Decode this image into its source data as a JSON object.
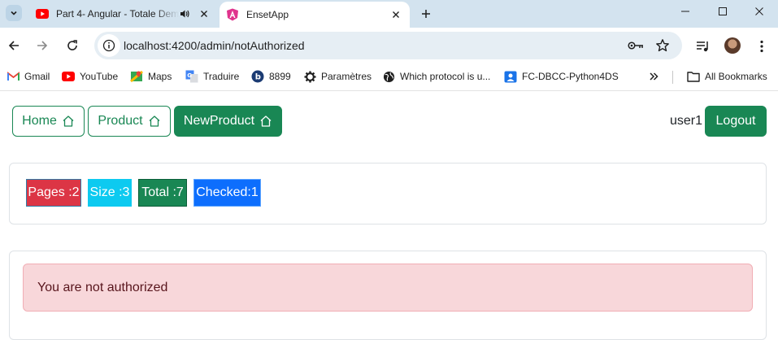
{
  "browser": {
    "tabs": [
      {
        "title": "Part 4- Angular - Totale Dem",
        "favicon": "youtube-icon",
        "active": false
      },
      {
        "title": "EnsetApp",
        "favicon": "angular-icon",
        "active": true
      }
    ],
    "url": "localhost:4200/admin/notAuthorized",
    "bookmarks": [
      {
        "label": "Gmail",
        "icon": "gmail-icon"
      },
      {
        "label": "YouTube",
        "icon": "youtube-icon"
      },
      {
        "label": "Maps",
        "icon": "maps-icon"
      },
      {
        "label": "Traduire",
        "icon": "translate-icon"
      },
      {
        "label": "8899",
        "icon": "b-logo-icon"
      },
      {
        "label": "Paramètres",
        "icon": "gear-icon"
      },
      {
        "label": "Which protocol is u...",
        "icon": "globe-icon"
      },
      {
        "label": "FC-DBCC-Python4DS",
        "icon": "person-card-icon"
      }
    ],
    "all_bookmarks_label": "All Bookmarks"
  },
  "nav": {
    "home_label": "Home",
    "product_label": "Product",
    "new_product_label": "NewProduct",
    "username": "user1",
    "logout_label": "Logout"
  },
  "stats": {
    "pages": "Pages :2",
    "size": "Size :3",
    "total": "Total :7",
    "checked": "Checked:1"
  },
  "alert": {
    "message": "You are not authorized"
  },
  "colors": {
    "success": "#198754",
    "danger": "#dc3545",
    "info": "#0dcaf0",
    "primary": "#0d6efd",
    "alert_bg": "#f8d7da",
    "tabstrip_bg": "#d3e3ef"
  }
}
